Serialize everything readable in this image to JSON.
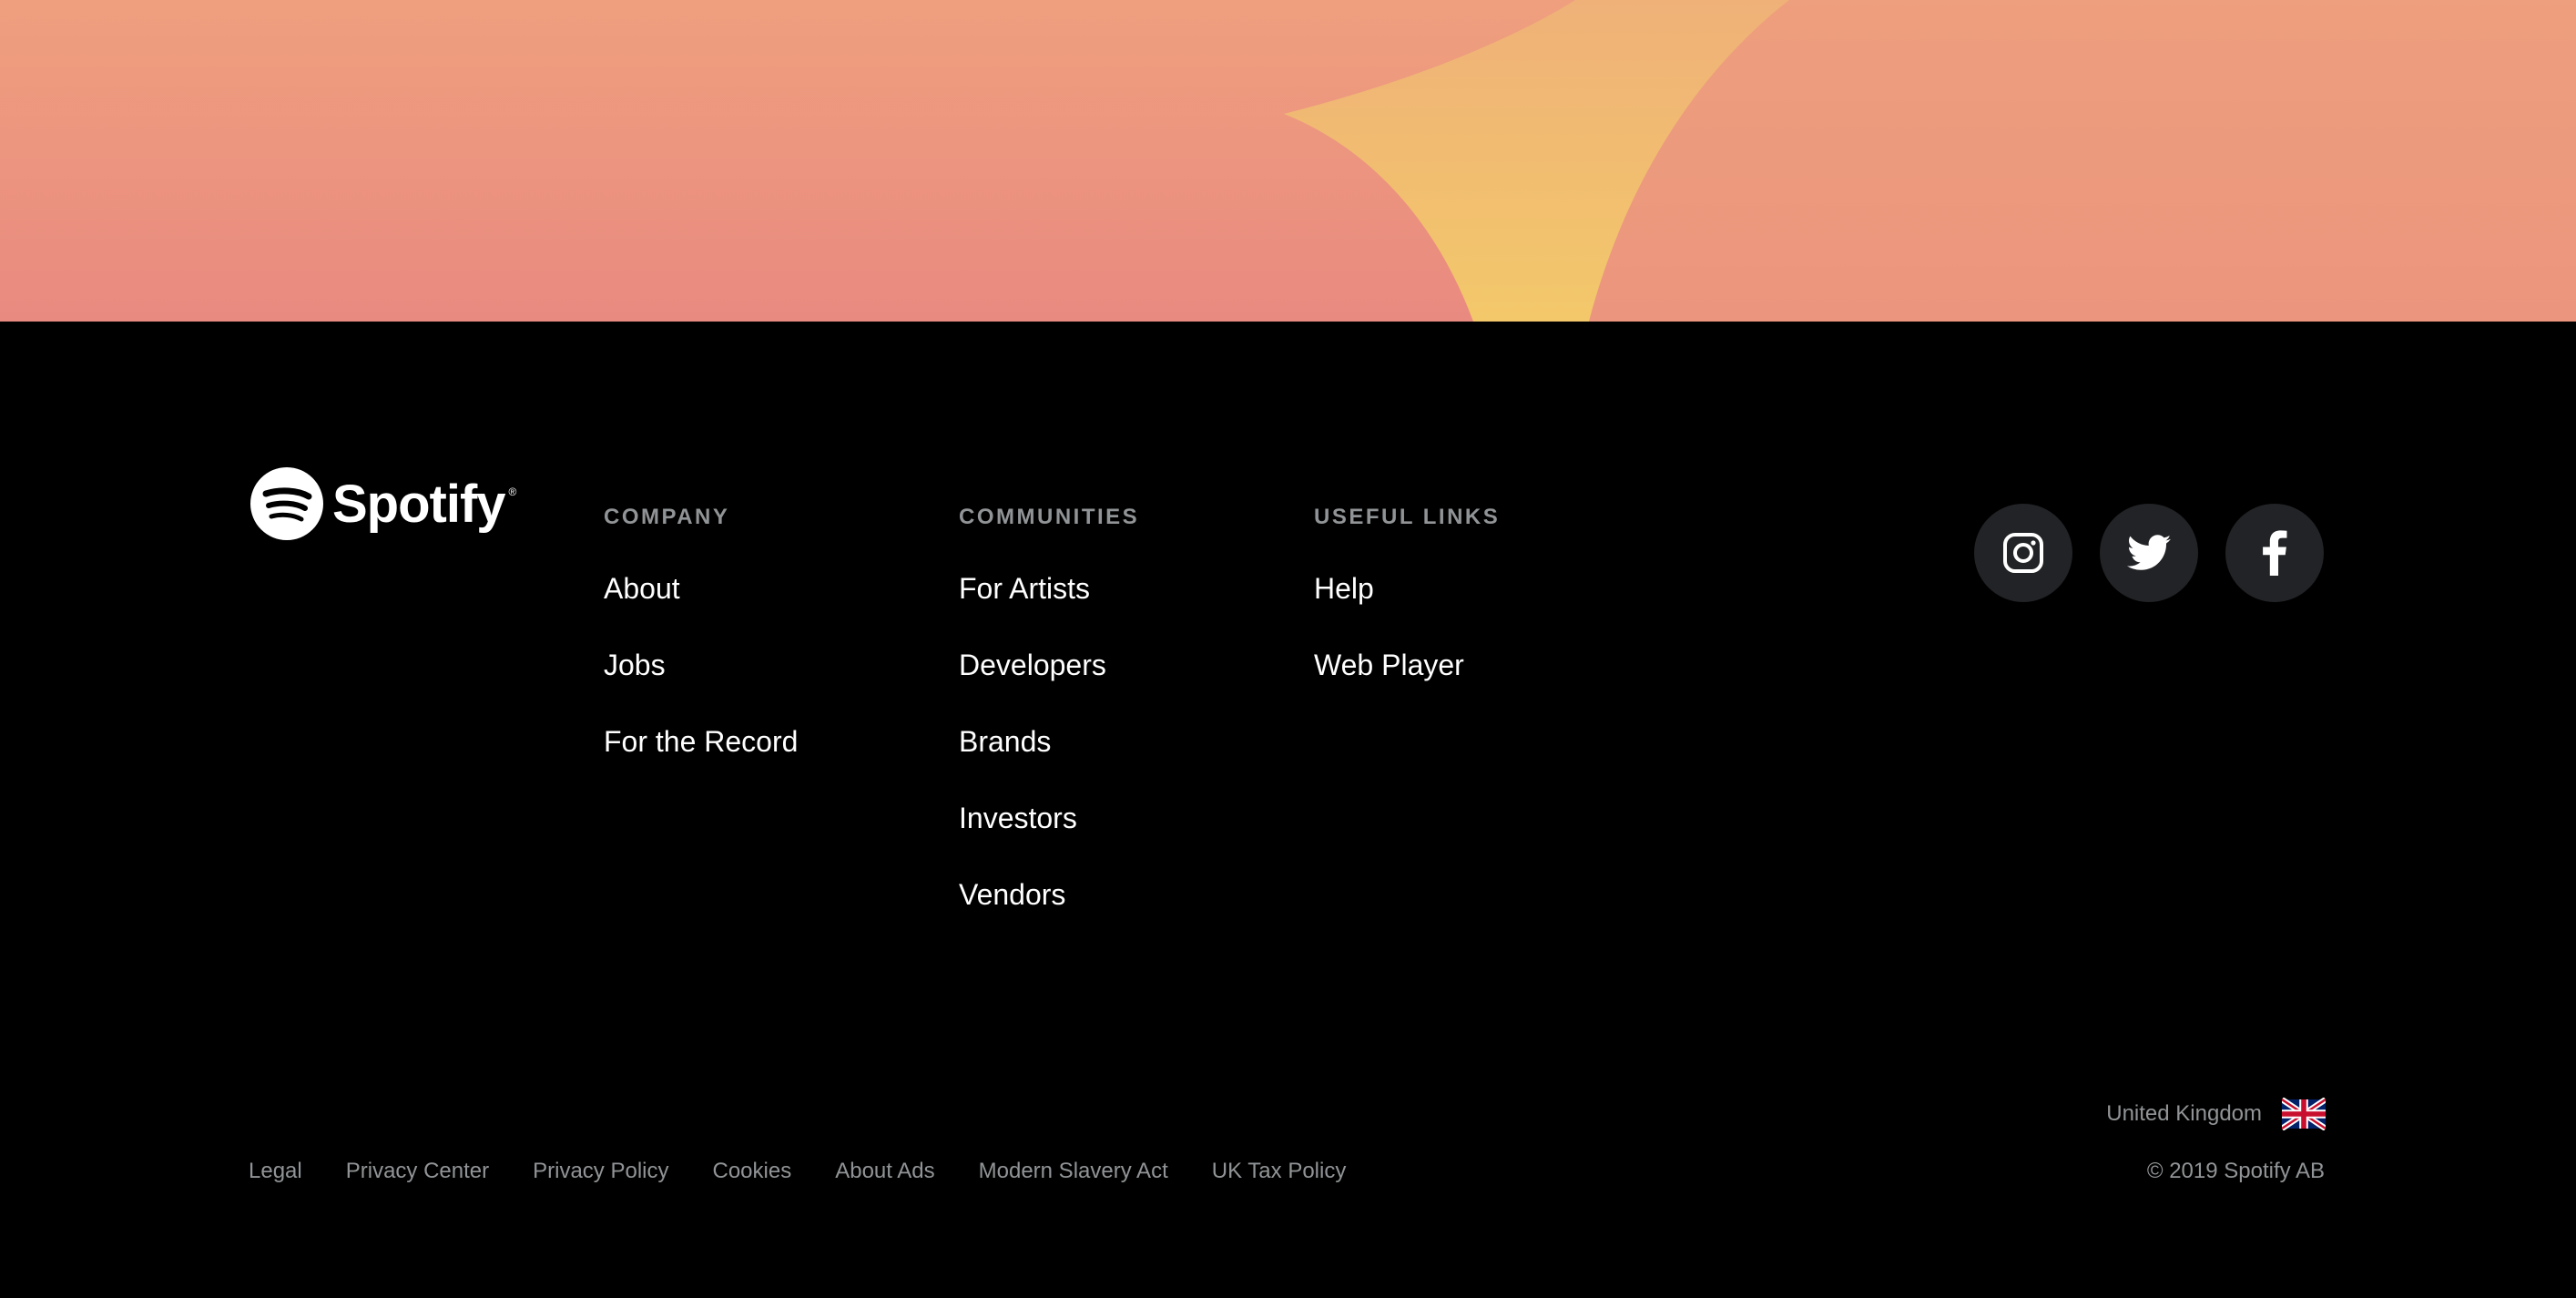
{
  "brand": {
    "name": "Spotify",
    "mark": "®"
  },
  "columns": [
    {
      "title": "COMPANY",
      "links": [
        {
          "label": "About"
        },
        {
          "label": "Jobs"
        },
        {
          "label": "For the Record"
        }
      ]
    },
    {
      "title": "COMMUNITIES",
      "links": [
        {
          "label": "For Artists"
        },
        {
          "label": "Developers"
        },
        {
          "label": "Brands"
        },
        {
          "label": "Investors"
        },
        {
          "label": "Vendors"
        }
      ]
    },
    {
      "title": "USEFUL LINKS",
      "links": [
        {
          "label": "Help"
        },
        {
          "label": "Web Player"
        }
      ]
    }
  ],
  "social": [
    {
      "icon": "instagram-icon"
    },
    {
      "icon": "twitter-icon"
    },
    {
      "icon": "facebook-icon"
    }
  ],
  "legal": [
    {
      "label": "Legal"
    },
    {
      "label": "Privacy Center"
    },
    {
      "label": "Privacy Policy"
    },
    {
      "label": "Cookies"
    },
    {
      "label": "About Ads"
    },
    {
      "label": "Modern Slavery Act"
    },
    {
      "label": "UK Tax Policy"
    }
  ],
  "country": {
    "label": "United Kingdom",
    "flag_icon": "uk-flag-icon"
  },
  "copyright": "© 2019 Spotify AB",
  "colors": {
    "hero_top": "#ef9f7e",
    "hero_bottom": "#e98a80",
    "hero_shape": "#f3c06a",
    "footer_bg": "#000000",
    "muted_text": "#919496",
    "social_bg": "#222326"
  }
}
